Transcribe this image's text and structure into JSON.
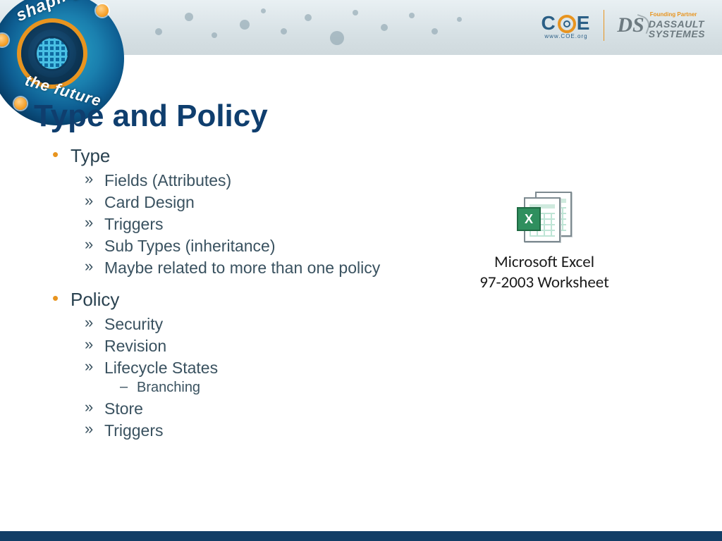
{
  "header": {
    "badge_top": "shaping",
    "badge_bottom": "the future",
    "coe_letters": {
      "c": "C",
      "e": "E"
    },
    "coe_sub": "www.COE.org",
    "ds_tag": "Founding Partner",
    "ds_line1": "DASSAULT",
    "ds_line2": "SYSTEMES",
    "ds_mark": "DS"
  },
  "title": "Type and Policy",
  "bullets": {
    "type": {
      "label": "Type",
      "items": [
        "Fields (Attributes)",
        "Card Design",
        "Triggers",
        "Sub Types (inheritance)",
        "Maybe related to more than one policy"
      ]
    },
    "policy": {
      "label": "Policy",
      "items": [
        "Security",
        "Revision",
        "Lifecycle States",
        "Store",
        "Triggers"
      ],
      "lifecycle_sub": "Branching"
    }
  },
  "embed": {
    "badge": "X",
    "caption_l1": "Microsoft Excel",
    "caption_l2": "97-2003 Worksheet"
  }
}
